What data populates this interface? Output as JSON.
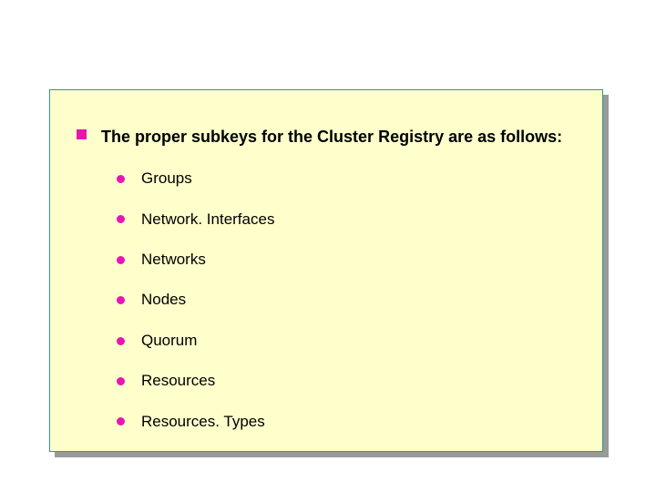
{
  "lead": "The proper subkeys for the Cluster Registry are as follows:",
  "items": [
    "Groups",
    "Network. Interfaces",
    "Networks",
    "Nodes",
    "Quorum",
    "Resources",
    "Resources. Types"
  ]
}
